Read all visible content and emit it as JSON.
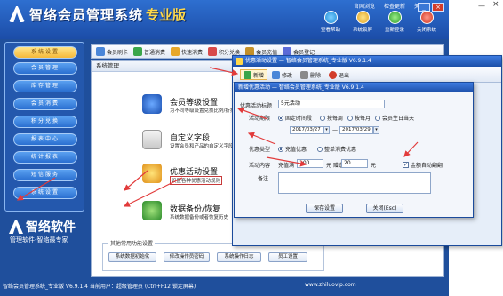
{
  "app": {
    "title": "智络会员管理系统",
    "edition": "专业版",
    "top_links": [
      "官网浏览",
      "检查更新",
      "关于"
    ],
    "top_tools": [
      "查看帮助",
      "系统锁屏",
      "重新登录",
      "关闭系统"
    ],
    "win_min": "_",
    "win_close": "×"
  },
  "sidebar": {
    "items": [
      {
        "label": "系统设置",
        "active": true
      },
      {
        "label": "会员管理",
        "active": false
      },
      {
        "label": "库存管理",
        "active": false
      },
      {
        "label": "会员消费",
        "active": false
      },
      {
        "label": "积分兑换",
        "active": false
      },
      {
        "label": "报表中心",
        "active": false
      },
      {
        "label": "统计报表",
        "active": false
      },
      {
        "label": "短信服务",
        "active": false
      },
      {
        "label": "系统设置",
        "active": false
      }
    ],
    "brand": "智络软件",
    "slogan": "管理软件-智络最专家"
  },
  "toolbar": {
    "items": [
      "会员刷卡",
      "普通消费",
      "快速消费",
      "积分兑换",
      "会员充值",
      "会员登记"
    ]
  },
  "content": {
    "header": "系统管理",
    "features": [
      {
        "title": "会员等级设置",
        "desc": "为不同等级设置兑换比例/折扣"
      },
      {
        "title": "自定义字段",
        "desc": "设置会员和产品的自定义字段"
      },
      {
        "title": "优惠活动设置",
        "desc": "设置各种优惠活动规则"
      },
      {
        "title": "数据备份/恢复",
        "desc": "系统数据备份或者恢复历史"
      }
    ],
    "other_legend": "其他常用功能设置",
    "other_buttons": [
      "系统数据初始化",
      "修改操作员密码",
      "系统操作日志",
      "员工设置"
    ]
  },
  "status": {
    "left": "智络会员管理系统_专业版 V6.9.1.4  当前用户：超级管理员  (Ctrl+F12 锁定屏幕)",
    "right": "www.zhiluovip.com"
  },
  "dialog1": {
    "title": "优惠活动设置 — 智络会员管理系统_专业版 V6.9.1.4",
    "tools": [
      "新增",
      "修改",
      "删除",
      "退出"
    ]
  },
  "dialog2": {
    "title": "新增优惠活动 — 智络会员管理系统_专业版 V6.9.1.4",
    "name_label": "优惠活动标题",
    "name_value": "5元活动",
    "period_label": "活动期限",
    "period_options": [
      {
        "label": "固定时间段",
        "on": true
      },
      {
        "label": "按每周",
        "on": false
      },
      {
        "label": "按每月",
        "on": false
      },
      {
        "label": "会员生日当天",
        "on": false
      }
    ],
    "date_start": "2017/03/27",
    "date_sep": "—",
    "date_end": "2017/03/29",
    "type_label": "优惠类型",
    "type_options": [
      {
        "label": "充值优惠",
        "on": true
      },
      {
        "label": "整单消费优惠",
        "on": false
      }
    ],
    "content_label": "活动内容",
    "content_prefix": "充值满",
    "amount_full": "100",
    "unit_1": "元 赠送",
    "amount_gift": "20",
    "unit_2": "元",
    "auto_gift_label": "金额自动翻翻",
    "auto_gift_checked": "✓",
    "remark_label": "备注",
    "remark_value": "",
    "save_label": "保存设置",
    "close_label": "关闭(Esc)"
  },
  "colors": {
    "brand_blue": "#1f4f9c",
    "accent_yellow": "#ffd84a",
    "annotation_red": "#e23b3b"
  }
}
